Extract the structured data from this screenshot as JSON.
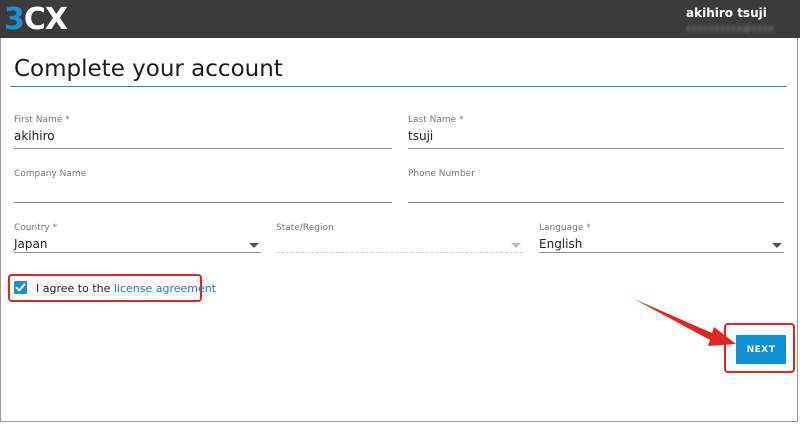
{
  "header": {
    "logo_digit": "3",
    "logo_letters": "CX",
    "user_name": "akihiro tsuji",
    "user_email": "xxxxxxxxxx@xxxxxxx"
  },
  "page": {
    "title": "Complete your account"
  },
  "form": {
    "first_name": {
      "label": "First Name *",
      "value": "akihiro"
    },
    "last_name": {
      "label": "Last Name *",
      "value": "tsuji"
    },
    "company_name": {
      "label": "Company Name",
      "value": ""
    },
    "phone_number": {
      "label": "Phone Number",
      "value": ""
    },
    "country": {
      "label": "Country *",
      "value": "Japan"
    },
    "state_region": {
      "label": "State/Region",
      "value": ""
    },
    "language": {
      "label": "Language *",
      "value": "English"
    },
    "agree": {
      "text": "I agree to the ",
      "link": "license agreement",
      "checked": true
    },
    "next_label": "NEXT"
  },
  "colors": {
    "accent": "#1f8fd0",
    "button": "#0f8fd6",
    "highlight": "#e2261f",
    "topbar": "#3b3b3b"
  },
  "icons": {
    "checkbox": "check-icon",
    "dropdown": "chevron-down-icon",
    "annotation": "red-arrow-icon"
  }
}
